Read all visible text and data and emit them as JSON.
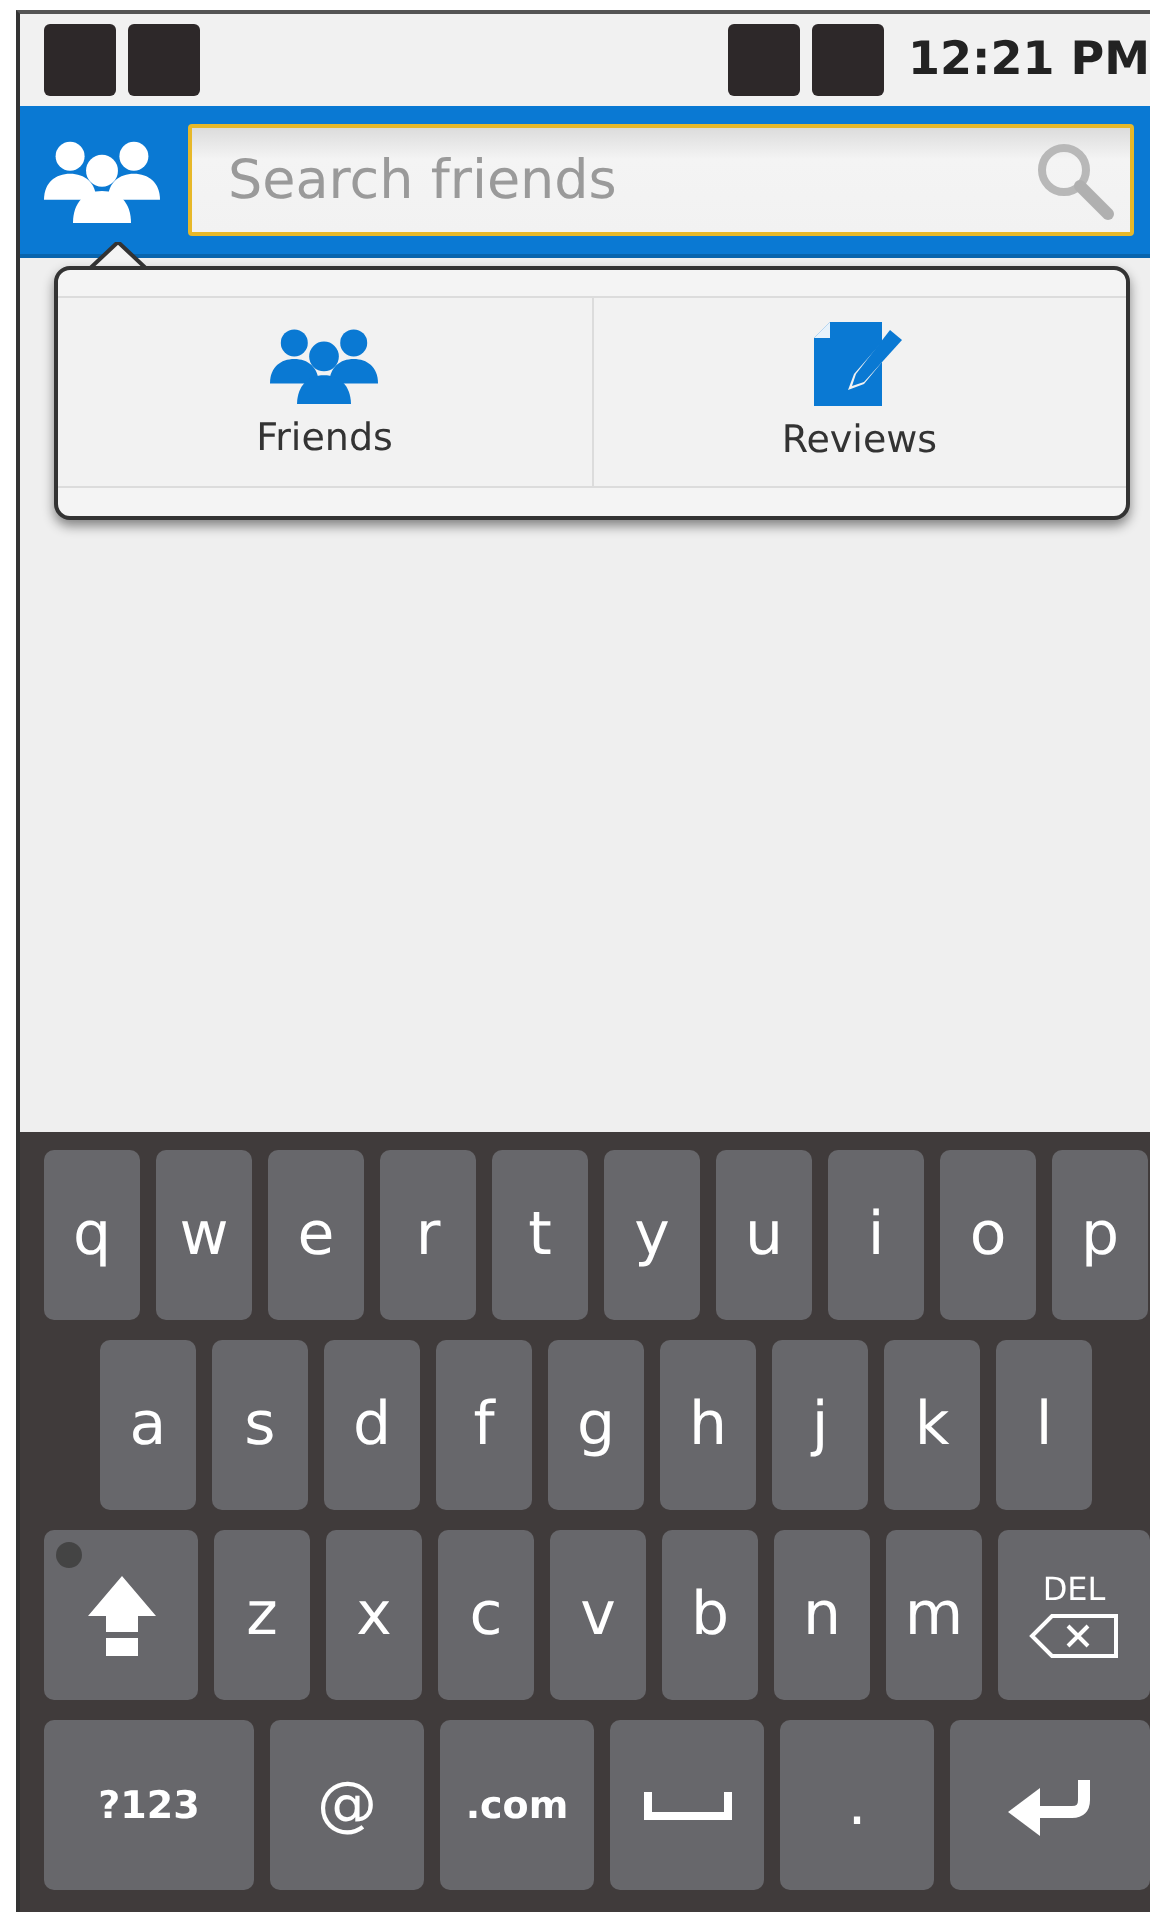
{
  "status_bar": {
    "time": "12:21 PM"
  },
  "search": {
    "placeholder": "Search friends"
  },
  "menu": {
    "items": [
      {
        "kind": "friends",
        "label": "Friends"
      },
      {
        "kind": "reviews",
        "label": "Reviews"
      }
    ]
  },
  "keyboard": {
    "key_rows": [
      {
        "keys": [
          {
            "kind": "letter",
            "label": "q"
          },
          {
            "kind": "letter",
            "label": "w"
          },
          {
            "kind": "letter",
            "label": "e"
          },
          {
            "kind": "letter",
            "label": "r"
          },
          {
            "kind": "letter",
            "label": "t"
          },
          {
            "kind": "letter",
            "label": "y"
          },
          {
            "kind": "letter",
            "label": "u"
          },
          {
            "kind": "letter",
            "label": "i"
          },
          {
            "kind": "letter",
            "label": "o"
          },
          {
            "kind": "letter",
            "label": "p"
          }
        ]
      },
      {
        "keys": [
          {
            "kind": "letter",
            "label": "a"
          },
          {
            "kind": "letter",
            "label": "s"
          },
          {
            "kind": "letter",
            "label": "d"
          },
          {
            "kind": "letter",
            "label": "f"
          },
          {
            "kind": "letter",
            "label": "g"
          },
          {
            "kind": "letter",
            "label": "h"
          },
          {
            "kind": "letter",
            "label": "j"
          },
          {
            "kind": "letter",
            "label": "k"
          },
          {
            "kind": "letter",
            "label": "l"
          }
        ]
      },
      {
        "keys": [
          {
            "kind": "shift"
          },
          {
            "kind": "letter",
            "label": "z"
          },
          {
            "kind": "letter",
            "label": "x"
          },
          {
            "kind": "letter",
            "label": "c"
          },
          {
            "kind": "letter",
            "label": "v"
          },
          {
            "kind": "letter",
            "label": "b"
          },
          {
            "kind": "letter",
            "label": "n"
          },
          {
            "kind": "letter",
            "label": "m"
          },
          {
            "kind": "delete",
            "label": "DEL"
          }
        ]
      },
      {
        "keys": [
          {
            "kind": "symbols",
            "label": "?123"
          },
          {
            "kind": "wide",
            "label": "@"
          },
          {
            "kind": "wide",
            "label": ".com"
          },
          {
            "kind": "space"
          },
          {
            "kind": "wide",
            "label": "."
          },
          {
            "kind": "enter"
          }
        ]
      }
    ]
  }
}
